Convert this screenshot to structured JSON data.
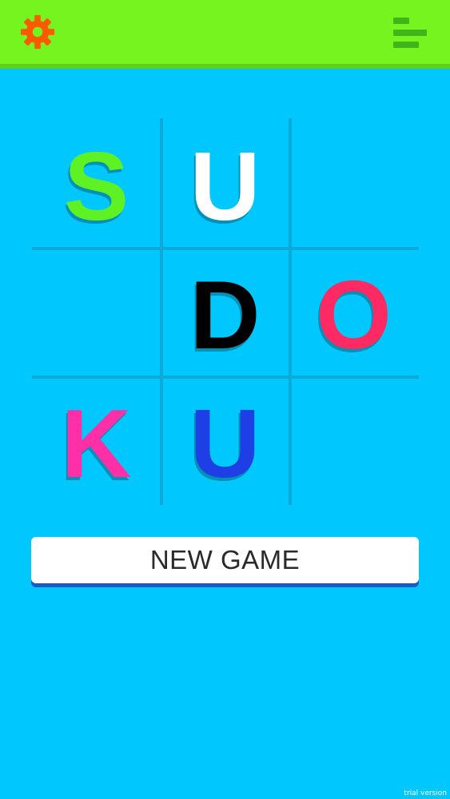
{
  "toolbar": {
    "settings_icon": "gear-icon",
    "leaderboard_icon": "leaderboard-icon",
    "settings_color": "#ff5a00",
    "leaderboard_color": "#3fb41b"
  },
  "title_grid": {
    "cells": [
      {
        "letter": "S",
        "color": "#5ef224"
      },
      {
        "letter": "U",
        "color": "#ffffff"
      },
      {
        "letter": "",
        "color": ""
      },
      {
        "letter": "",
        "color": ""
      },
      {
        "letter": "D",
        "color": "#000000"
      },
      {
        "letter": "O",
        "color": "#ff2a63"
      },
      {
        "letter": "K",
        "color": "#ff2fa8"
      },
      {
        "letter": "U",
        "color": "#1f3fe6"
      },
      {
        "letter": "",
        "color": ""
      }
    ]
  },
  "actions": {
    "new_game_label": "NEW GAME"
  },
  "footer": {
    "watermark": "trial version"
  },
  "colors": {
    "background": "#00c8ff",
    "topbar": "#76f41f"
  }
}
